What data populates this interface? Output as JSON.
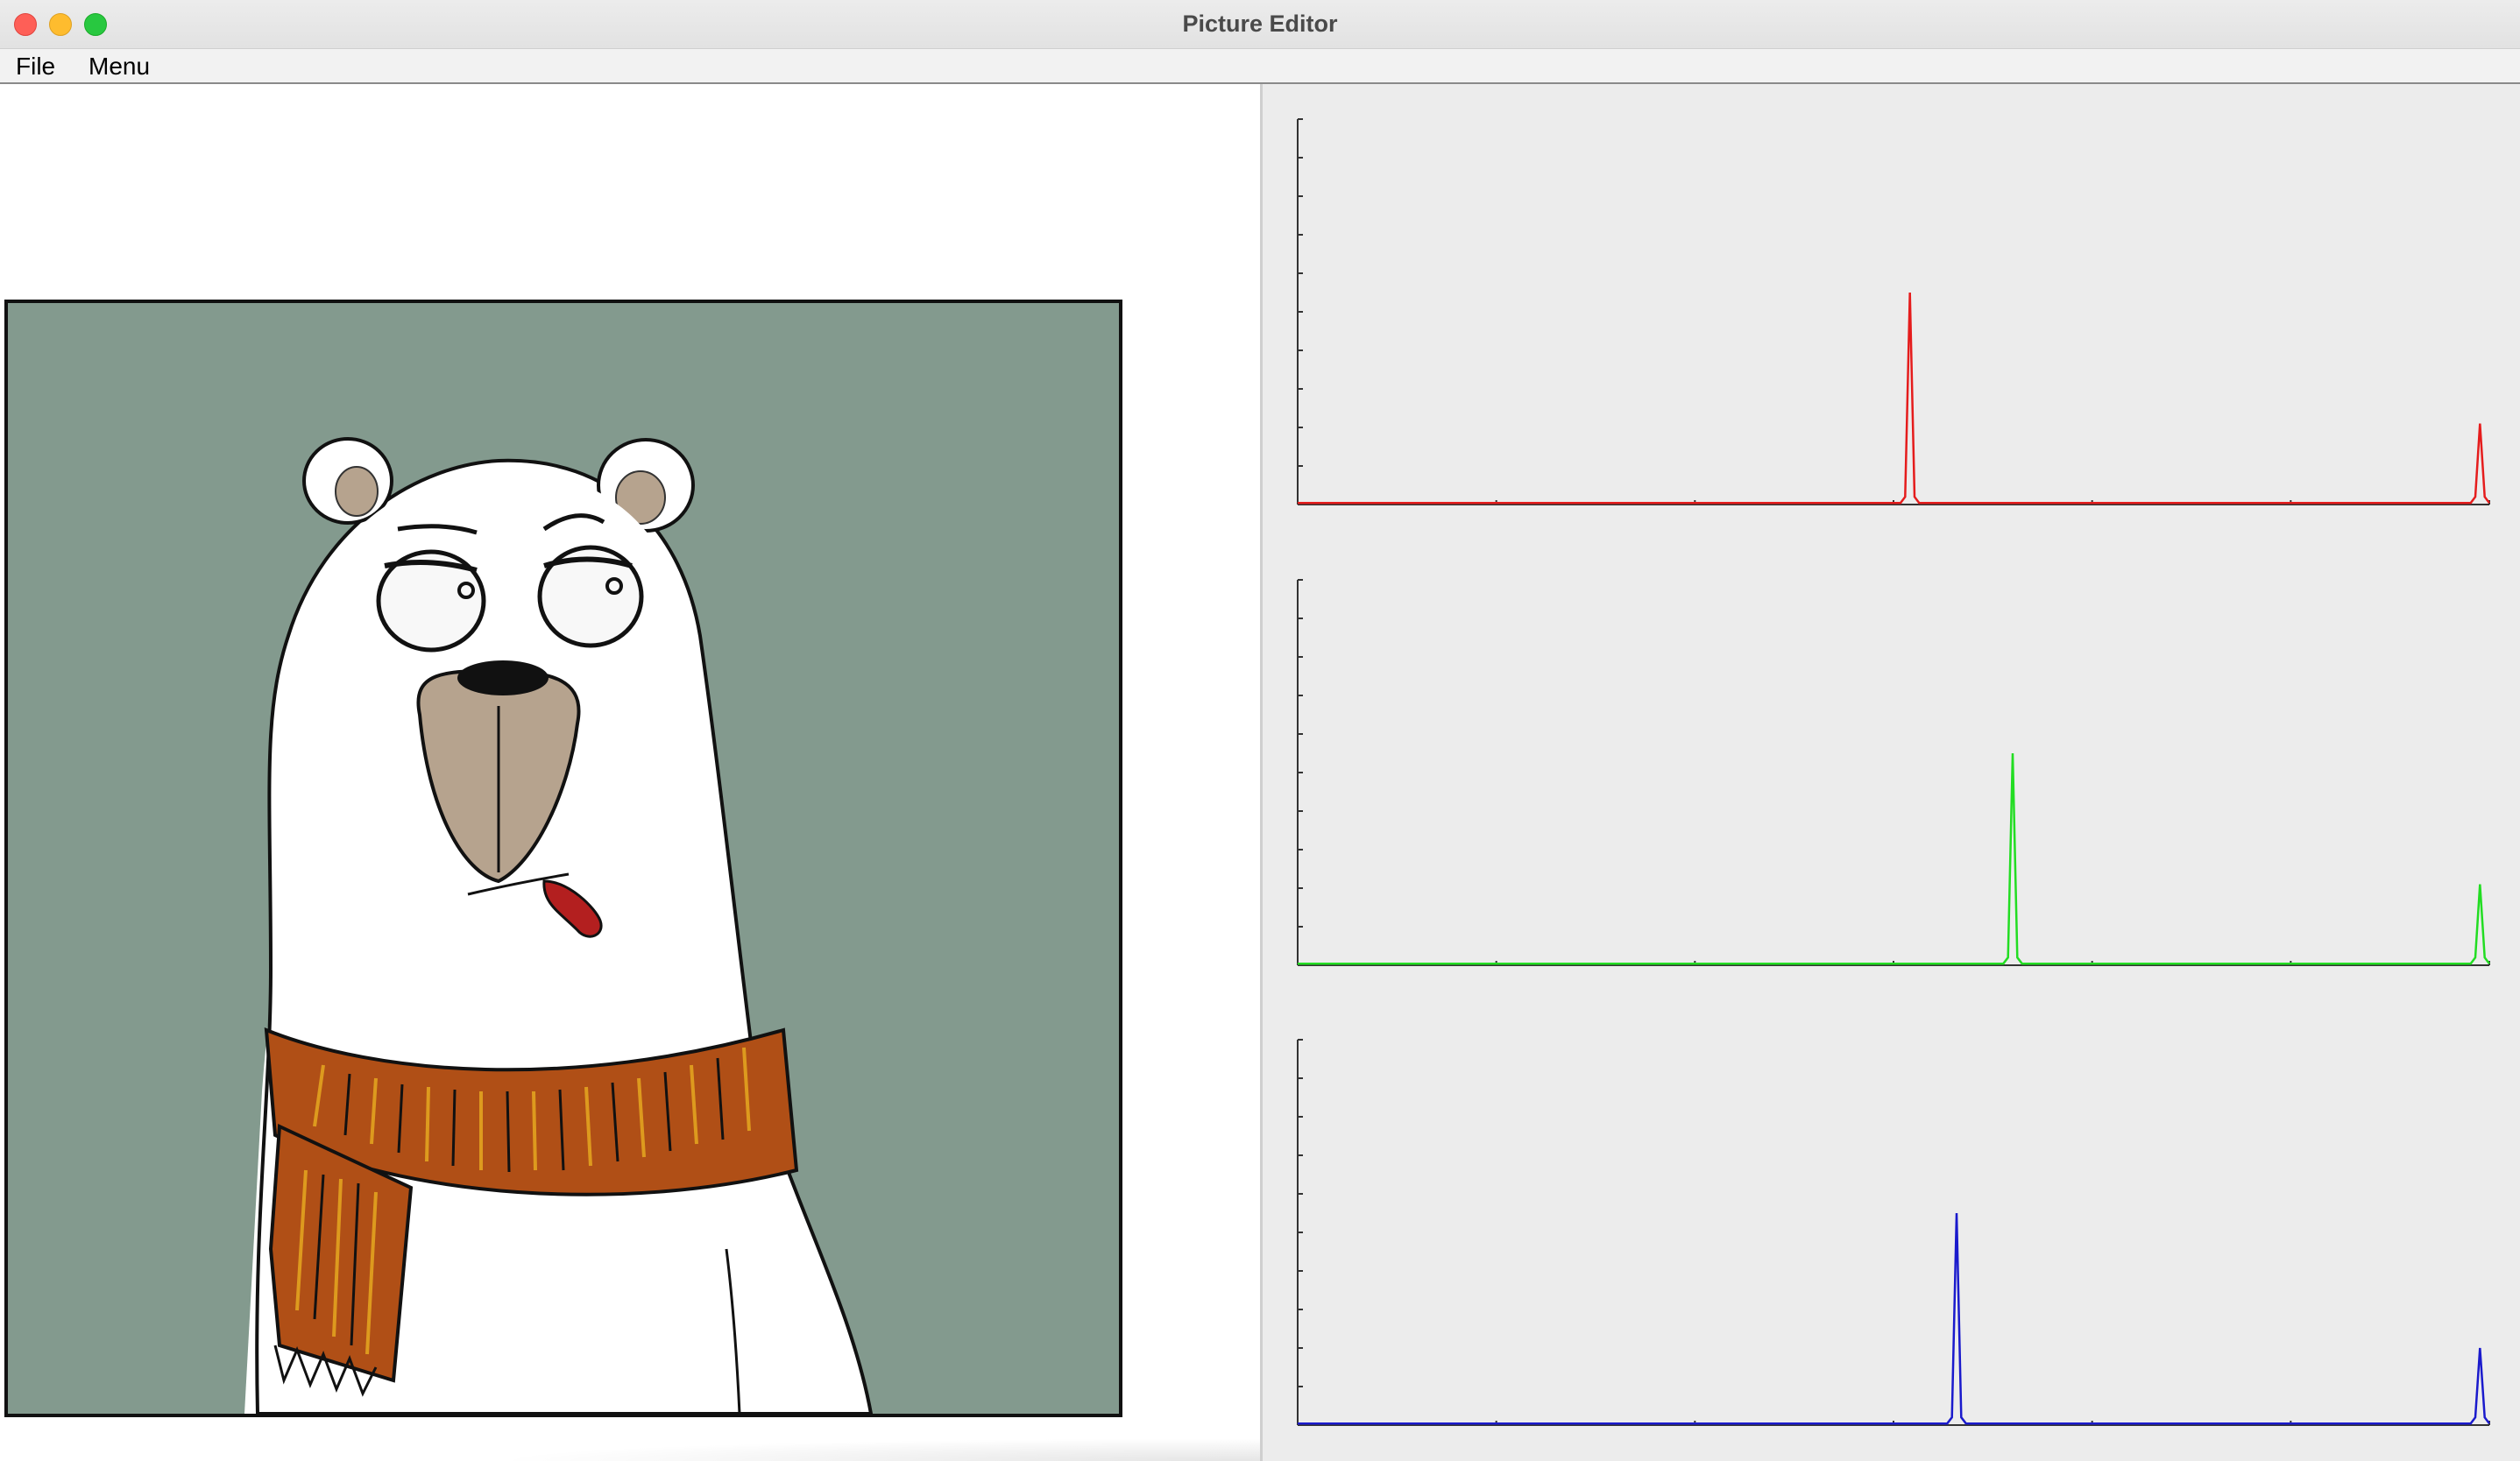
{
  "window": {
    "title": "Picture Editor"
  },
  "menubar": {
    "items": [
      {
        "label": "File"
      },
      {
        "label": "Menu"
      }
    ]
  },
  "canvas": {
    "image_description_icon": "polar-bear-illustration",
    "background_color": "#839a8e"
  },
  "histograms": [
    {
      "channel": "red",
      "color": "#e51c1c",
      "peaks": [
        {
          "bin": 131,
          "level": 0.55
        },
        {
          "bin": 253,
          "level": 0.21
        }
      ]
    },
    {
      "channel": "green",
      "color": "#22dd22",
      "peaks": [
        {
          "bin": 153,
          "level": 0.55
        },
        {
          "bin": 253,
          "level": 0.21
        }
      ]
    },
    {
      "channel": "blue",
      "color": "#1a1acc",
      "peaks": [
        {
          "bin": 141,
          "level": 0.55
        },
        {
          "bin": 253,
          "level": 0.2
        }
      ]
    }
  ]
}
